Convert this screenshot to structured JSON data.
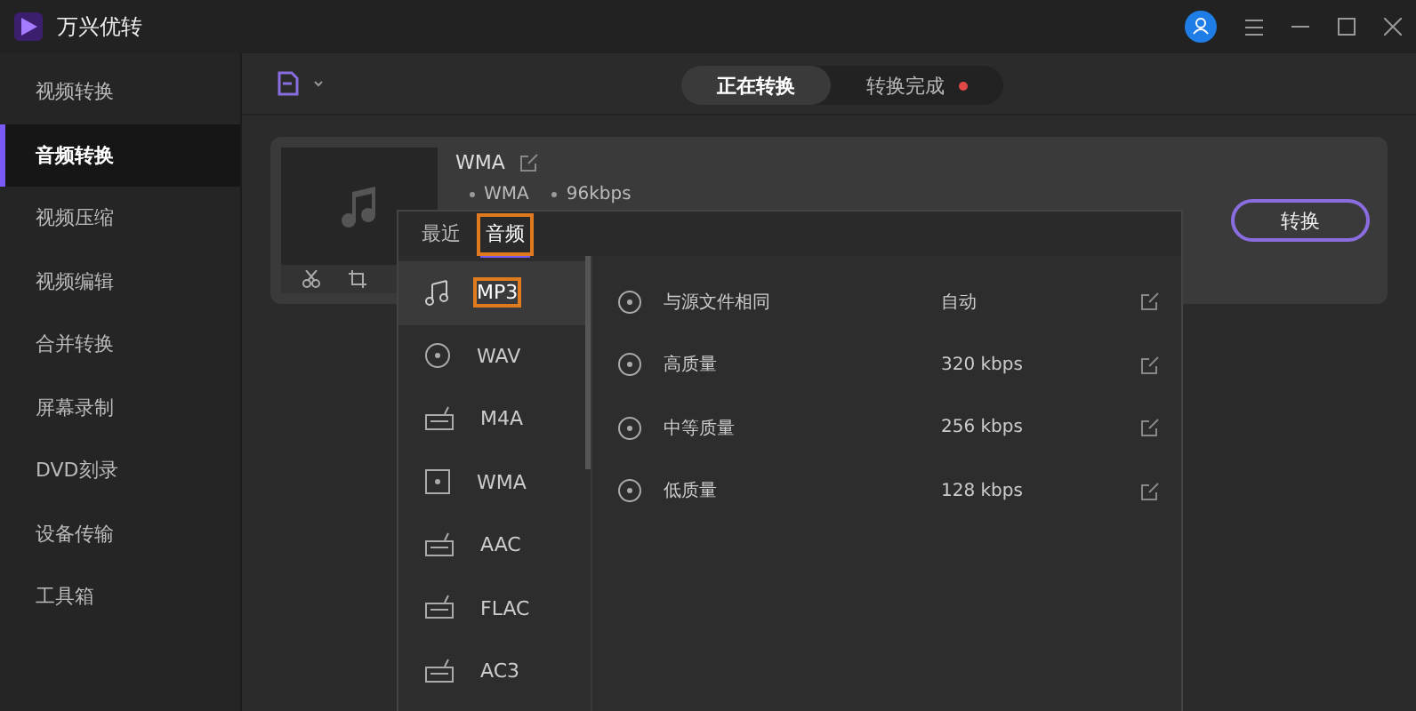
{
  "window": {
    "title": "万兴优转"
  },
  "sidebar": {
    "items": [
      {
        "label": "视频转换",
        "selected": false
      },
      {
        "label": "音频转换",
        "selected": true
      },
      {
        "label": "视频压缩",
        "selected": false
      },
      {
        "label": "视频编辑",
        "selected": false
      },
      {
        "label": "合并转换",
        "selected": false
      },
      {
        "label": "屏幕录制",
        "selected": false
      },
      {
        "label": "DVD刻录",
        "selected": false
      },
      {
        "label": "设备传输",
        "selected": false
      },
      {
        "label": "工具箱",
        "selected": false
      }
    ]
  },
  "status_tabs": [
    {
      "label": "正在转换",
      "selected": true,
      "badge": false
    },
    {
      "label": "转换完成",
      "selected": false,
      "badge": true
    }
  ],
  "file": {
    "name": "WMA",
    "format": "WMA",
    "bitrate": "96kbps"
  },
  "convert_button": "转换",
  "format_popup": {
    "tabs": [
      {
        "label": "最近",
        "selected": false
      },
      {
        "label": "音频",
        "selected": true
      }
    ],
    "formats": [
      {
        "label": "MP3",
        "selected": true
      },
      {
        "label": "WAV",
        "selected": false
      },
      {
        "label": "M4A",
        "selected": false
      },
      {
        "label": "WMA",
        "selected": false
      },
      {
        "label": "AAC",
        "selected": false
      },
      {
        "label": "FLAC",
        "selected": false
      },
      {
        "label": "AC3",
        "selected": false
      }
    ],
    "presets": [
      {
        "name": "与源文件相同",
        "bitrate": "自动"
      },
      {
        "name": "高质量",
        "bitrate": "320 kbps"
      },
      {
        "name": "中等质量",
        "bitrate": "256 kbps"
      },
      {
        "name": "低质量",
        "bitrate": "128 kbps"
      }
    ]
  }
}
